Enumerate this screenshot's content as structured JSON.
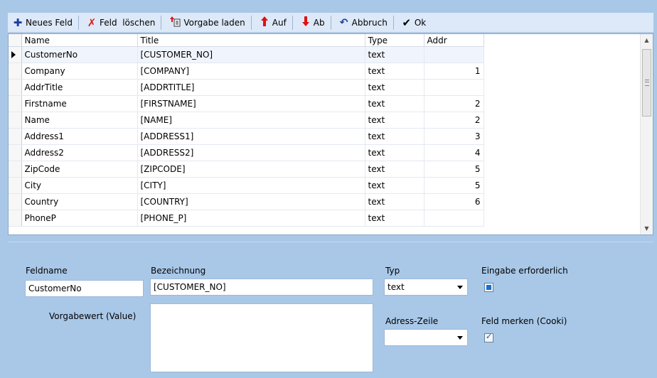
{
  "toolbar": {
    "new_field": "Neues Feld",
    "delete_field": "Feld  löschen",
    "load_default": "Vorgabe laden",
    "up": "Auf",
    "down": "Ab",
    "cancel": "Abbruch",
    "ok": "Ok",
    "icons": [
      "plus-icon",
      "delete-x-icon",
      "load-template-icon",
      "arrow-up-icon",
      "arrow-down-icon",
      "undo-icon",
      "checkmark-icon"
    ],
    "colors": {
      "plus": "#1a3fa0",
      "delete": "#d81e1e",
      "arrow": "#e01010",
      "check": "#000000"
    }
  },
  "grid": {
    "columns": [
      "Name",
      "Title",
      "Type",
      "Addr"
    ],
    "rows": [
      {
        "name": "CustomerNo",
        "title": "[CUSTOMER_NO]",
        "type": "text",
        "addr": ""
      },
      {
        "name": "Company",
        "title": "[COMPANY]",
        "type": "text",
        "addr": "1"
      },
      {
        "name": "AddrTitle",
        "title": "[ADDRTITLE]",
        "type": "text",
        "addr": ""
      },
      {
        "name": "Firstname",
        "title": "[FIRSTNAME]",
        "type": "text",
        "addr": "2"
      },
      {
        "name": "Name",
        "title": "[NAME]",
        "type": "text",
        "addr": "2"
      },
      {
        "name": "Address1",
        "title": "[ADDRESS1]",
        "type": "text",
        "addr": "3"
      },
      {
        "name": "Address2",
        "title": "[ADDRESS2]",
        "type": "text",
        "addr": "4"
      },
      {
        "name": "ZipCode",
        "title": "[ZIPCODE]",
        "type": "text",
        "addr": "5"
      },
      {
        "name": "City",
        "title": "[CITY]",
        "type": "text",
        "addr": "5"
      },
      {
        "name": "Country",
        "title": "[COUNTRY]",
        "type": "text",
        "addr": "6"
      },
      {
        "name": "PhoneP",
        "title": "[PHONE_P]",
        "type": "text",
        "addr": ""
      }
    ],
    "selected_row": 0
  },
  "form": {
    "fieldname_label": "Feldname",
    "fieldname_value": "CustomerNo",
    "designation_label": "Bezeichnung",
    "designation_value": "[CUSTOMER_NO]",
    "type_label": "Typ",
    "type_value": "text",
    "required_label": "Eingabe erforderlich",
    "default_label": "Vorgabewert (Value)",
    "default_value": "",
    "address_line_label": "Adress-Zeile",
    "address_line_value": "",
    "remember_label": "Feld merken (Cooki)",
    "required_checked": false,
    "remember_checked": true
  }
}
